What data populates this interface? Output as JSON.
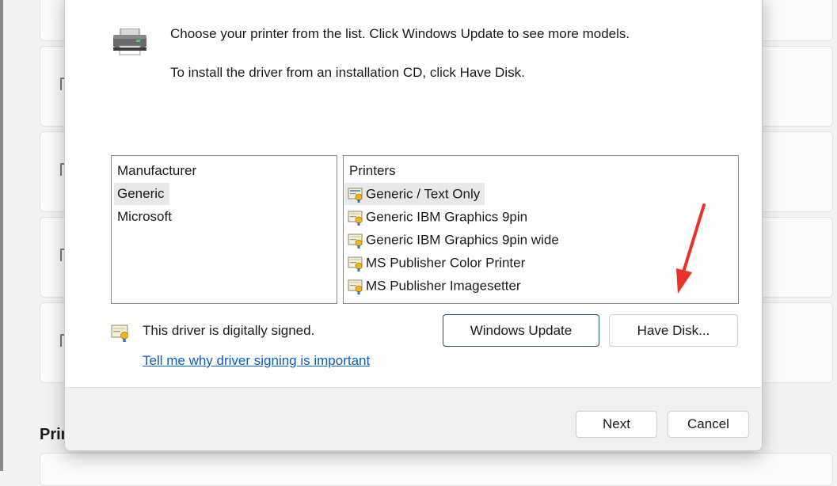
{
  "background": {
    "partial_heading": "Prin"
  },
  "dialog": {
    "intro_line1": "Choose your printer from the list. Click Windows Update to see more models.",
    "intro_line2": "To install the driver from an installation CD, click Have Disk.",
    "manufacturer_list": {
      "header": "Manufacturer",
      "items": [
        {
          "label": "Generic",
          "selected": true
        },
        {
          "label": "Microsoft",
          "selected": false
        }
      ]
    },
    "printers_list": {
      "header": "Printers",
      "items": [
        {
          "label": "Generic / Text Only",
          "selected": true
        },
        {
          "label": "Generic IBM Graphics 9pin",
          "selected": false
        },
        {
          "label": "Generic IBM Graphics 9pin wide",
          "selected": false
        },
        {
          "label": "MS Publisher Color Printer",
          "selected": false
        },
        {
          "label": "MS Publisher Imagesetter",
          "selected": false
        }
      ]
    },
    "signed_text": "This driver is digitally signed.",
    "signing_link": "Tell me why driver signing is important",
    "windows_update_button": "Windows Update",
    "have_disk_button": "Have Disk...",
    "next_button": "Next",
    "cancel_button": "Cancel"
  },
  "icons": {
    "printer": "printer-icon",
    "certificate": "certificate-icon",
    "annotation": "red-arrow-icon"
  },
  "colors": {
    "link": "#0a5ec7",
    "annotation_arrow": "#e8322a",
    "selection": "#e8e8e8"
  }
}
